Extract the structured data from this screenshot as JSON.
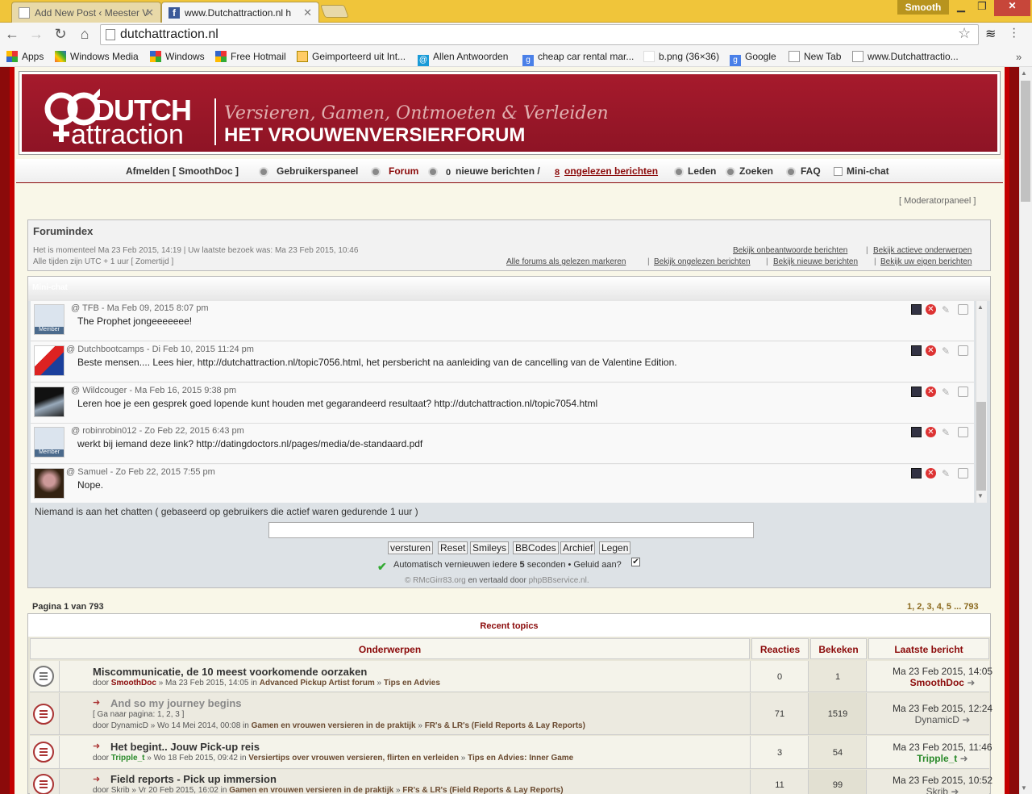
{
  "browser": {
    "tabs": [
      {
        "title": "Add New Post ‹ Meester V"
      },
      {
        "title": "www.Dutchattraction.nl h"
      }
    ],
    "profile": "Smooth",
    "url": "dutchattraction.nl",
    "bookmarks": [
      "Apps",
      "Windows Media",
      "Windows",
      "Free Hotmail",
      "Geimporteerd uit Int...",
      "Allen Antwoorden",
      "cheap car rental mar...",
      "b.png (36×36)",
      "Google",
      "New Tab",
      "www.Dutchattractio..."
    ]
  },
  "header": {
    "logo_top": "DUTCH",
    "logo_bottom": "attraction",
    "tagline": "Versieren, Gamen, Ontmoeten & Verleiden",
    "subtitle": "HET VROUWENVERSIERFORUM"
  },
  "nav": {
    "logout": "Afmelden [ SmoothDoc ]",
    "ucp": "Gebruikerspaneel",
    "forum": "Forum",
    "new_count": "0",
    "new_posts": "nieuwe berichten /",
    "unread_count": "8",
    "unread": "ongelezen berichten",
    "members": "Leden",
    "search": "Zoeken",
    "faq": "FAQ",
    "minichat": "Mini-chat"
  },
  "modpanel": "[ Moderatorpaneel ]",
  "forumindex": {
    "title": "Forumindex",
    "now": "Het is momenteel Ma 23 Feb 2015, 14:19 | Uw laatste bezoek was: Ma 23 Feb 2015, 10:46",
    "tz": "Alle tijden zijn UTC + 1 uur [ Zomertijd ]",
    "links1": [
      "Bekijk onbeantwoorde berichten",
      "Bekijk actieve onderwerpen"
    ],
    "links2": [
      "Alle forums als gelezen markeren",
      "Bekijk ongelezen berichten",
      "Bekijk nieuwe berichten",
      "Bekijk uw eigen berichten"
    ]
  },
  "chat": {
    "title": "Mini-chat",
    "messages": [
      {
        "user": "TFB",
        "date": "Ma Feb 09, 2015 8:07 pm",
        "text": "The Prophet jongeeeeeee!"
      },
      {
        "user": "Dutchbootcamps",
        "date": "Di Feb 10, 2015 11:24 pm",
        "text": "Beste mensen.... Lees hier, http://dutchattraction.nl/topic7056.html, het persbericht na aanleiding van de cancelling van de Valentine Edition."
      },
      {
        "user": "Wildcouger",
        "date": "Ma Feb 16, 2015 9:38 pm",
        "text": "Leren hoe je een gesprek goed lopende kunt houden met gegarandeerd resultaat? http://dutchattraction.nl/topic7054.html"
      },
      {
        "user": "robinrobin012",
        "date": "Zo Feb 22, 2015 6:43 pm",
        "text": "werkt bij iemand deze link? http://datingdoctors.nl/pages/media/de-standaard.pdf"
      },
      {
        "user": "Samuel",
        "date": "Zo Feb 22, 2015 7:55 pm",
        "text": "Nope."
      }
    ],
    "member_badge": "Member",
    "nobody": "Niemand is aan het chatten ( gebaseerd op gebruikers die actief waren gedurende 1 uur )",
    "buttons": [
      "versturen",
      "Reset",
      "Smileys",
      "BBCodes",
      "Archief",
      "Legen"
    ],
    "auto_a": "Automatisch vernieuwen iedere",
    "auto_n": "5",
    "auto_b": "seconden • Geluid aan?",
    "credits_a": "© RMcGirr83.org",
    "credits_b": "en vertaald door",
    "credits_c": "phpBBservice.nl."
  },
  "pagination": {
    "label": "Pagina 1 van 793",
    "pages": "1, 2, 3, 4, 5 ... 793"
  },
  "topics": {
    "title": "Recent topics",
    "headers": {
      "topic": "Onderwerpen",
      "replies": "Reacties",
      "views": "Bekeken",
      "last": "Laatste bericht"
    },
    "rows": [
      {
        "title": "Miscommunicatie, de 10 meest voorkomende oorzaken",
        "by": "door",
        "author": "SmoothDoc",
        "date": "» Ma 23 Feb 2015, 14:05 in",
        "forum": "Advanced Pickup Artist forum",
        "sub": "Tips en Advies",
        "replies": "0",
        "views": "1",
        "last_date": "Ma 23 Feb 2015, 14:05",
        "last_user": "SmoothDoc"
      },
      {
        "title": "And so my journey begins",
        "goto": "[ Ga naar pagina: 1, 2, 3 ]",
        "by": "door",
        "author": "DynamicD",
        "date": "» Wo 14 Mei 2014, 00:08 in",
        "forum": "Gamen en vrouwen versieren in de praktijk",
        "sub": "FR's & LR's (Field Reports & Lay Reports)",
        "replies": "71",
        "views": "1519",
        "last_date": "Ma 23 Feb 2015, 12:24",
        "last_user": "DynamicD"
      },
      {
        "title": "Het begint.. Jouw Pick-up reis",
        "by": "door",
        "author": "Tripple_t",
        "date": "» Wo 18 Feb 2015, 09:42 in",
        "forum": "Versiertips over vrouwen versieren, flirten en verleiden",
        "sub": "Tips en Advies: Inner Game",
        "replies": "3",
        "views": "54",
        "last_date": "Ma 23 Feb 2015, 11:46",
        "last_user": "Tripple_t"
      },
      {
        "title": "Field reports - Pick up immersion",
        "by": "door",
        "author": "Skrib",
        "date": "» Vr 20 Feb 2015, 16:02 in",
        "forum": "Gamen en vrouwen versieren in de praktijk",
        "sub": "FR's & LR's (Field Reports & Lay Reports)",
        "replies": "11",
        "views": "99",
        "last_date": "Ma 23 Feb 2015, 10:52",
        "last_user": "Skrib"
      }
    ]
  }
}
